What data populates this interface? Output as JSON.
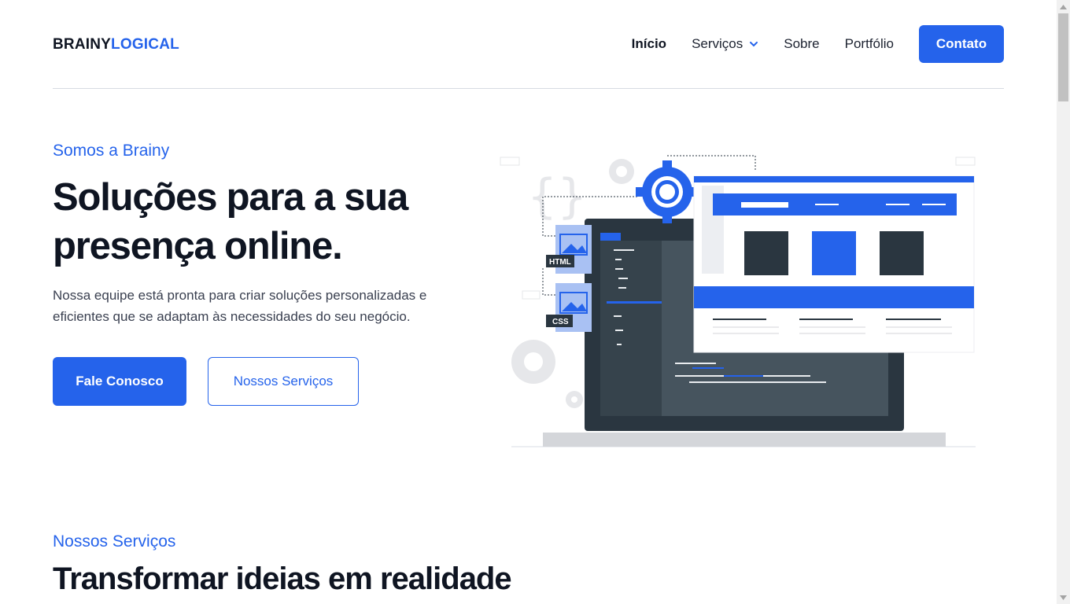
{
  "header": {
    "logo_part1": "BRAINY",
    "logo_part2": "LOGICAL",
    "nav": [
      {
        "label": "Início",
        "active": true
      },
      {
        "label": "Serviços",
        "has_dropdown": true
      },
      {
        "label": "Sobre"
      },
      {
        "label": "Portfólio"
      }
    ],
    "cta_label": "Contato"
  },
  "hero": {
    "eyebrow": "Somos a Brainy",
    "title_line1": "Soluções para a sua",
    "title_line2": "presença online",
    "title_dot": ".",
    "description": "Nossa equipe está pronta para criar soluções personalizadas e eficientes que se adaptam às necessidades do seu negócio.",
    "primary_button": "Fale Conosco",
    "secondary_button": "Nossos Serviços",
    "illustration": {
      "file_labels": [
        "HTML",
        "CSS"
      ],
      "icons": [
        "gear-icon",
        "braces-icon",
        "image-file-icon",
        "laptop-icon",
        "browser-window-icon"
      ]
    }
  },
  "services": {
    "eyebrow": "Nossos Serviços",
    "title": "Transformar ideias em realidade"
  },
  "colors": {
    "accent": "#2563eb",
    "text": "#0f1522",
    "muted": "#3a4050"
  }
}
